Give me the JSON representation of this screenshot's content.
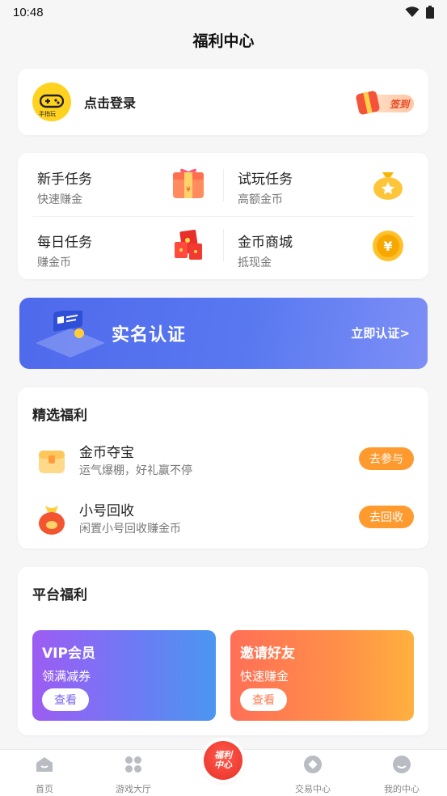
{
  "status_bar": {
    "time": "10:48"
  },
  "header": {
    "title": "福利中心"
  },
  "login": {
    "avatar_badge": "手指玩",
    "label": "点击登录",
    "checkin_label": "签到"
  },
  "tasks": [
    {
      "title": "新手任务",
      "subtitle": "快速赚金",
      "icon": "gift-box-icon"
    },
    {
      "title": "试玩任务",
      "subtitle": "高额金币",
      "icon": "coin-bag-icon"
    },
    {
      "title": "每日任务",
      "subtitle": "赚金币",
      "icon": "red-envelope-icon"
    },
    {
      "title": "金币商城",
      "subtitle": "抵现金",
      "icon": "yuan-coin-icon"
    }
  ],
  "banner": {
    "title": "实名认证",
    "link": "立即认证>"
  },
  "featured": {
    "title": "精选福利",
    "items": [
      {
        "title": "金币夺宝",
        "subtitle": "运气爆棚，好礼赢不停",
        "button": "去参与"
      },
      {
        "title": "小号回收",
        "subtitle": "闲置小号回收赚金币",
        "button": "去回收"
      }
    ]
  },
  "platform": {
    "title": "平台福利",
    "vip": {
      "title": "VIP会员",
      "subtitle": "领满减券",
      "button": "查看"
    },
    "invite": {
      "title": "邀请好友",
      "subtitle": "快速赚金",
      "button": "查看"
    }
  },
  "nav": {
    "items": [
      {
        "label": "首页",
        "icon": "home-icon"
      },
      {
        "label": "游戏大厅",
        "icon": "grid-icon"
      },
      {
        "label": "交易中心",
        "icon": "trade-icon"
      },
      {
        "label": "我的中心",
        "icon": "profile-icon"
      }
    ],
    "center_label_1": "福利",
    "center_label_2": "中心"
  },
  "colors": {
    "accent_orange": "#ff9a2e",
    "banner_blue": "#5878f0",
    "vip_purple": "#9d5cf3",
    "invite_orange": "#ff7a4b",
    "center_red": "#e8302a"
  }
}
